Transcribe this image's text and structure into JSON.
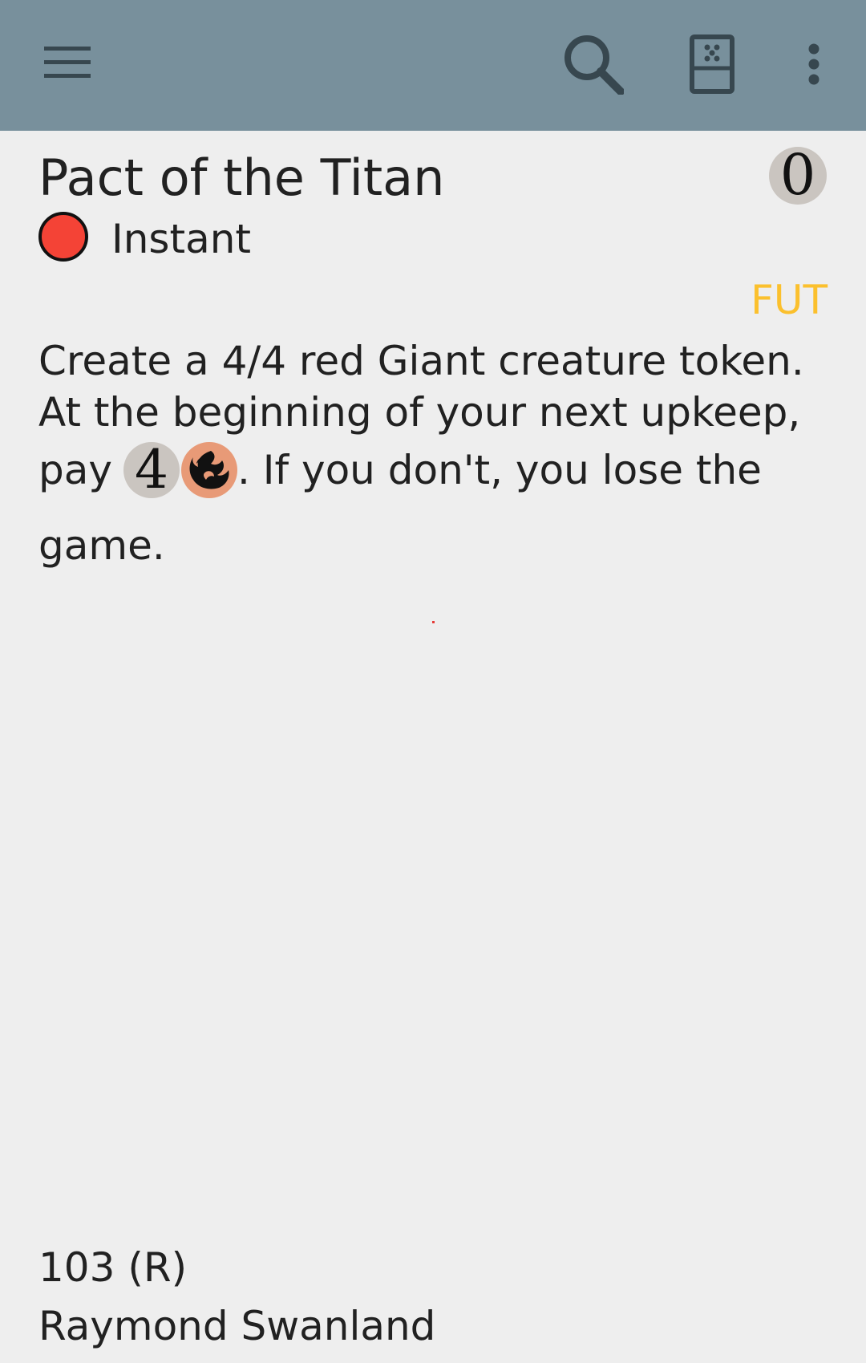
{
  "toolbar": {
    "menu_icon": "hamburger-menu-icon",
    "search_icon": "search-icon",
    "deck_icon": "deck-icon",
    "more_icon": "more-vert-icon"
  },
  "card": {
    "name": "Pact of the Titan",
    "mana_cost": "0",
    "color_indicator": "#f44336",
    "type_line": "Instant",
    "set_code": "FUT",
    "rules_text": {
      "line1": "Create a 4/4 red Giant creature token.",
      "line2": "At the beginning of your next upkeep,",
      "line3_before": "pay",
      "cost_generic": "4",
      "cost_red_icon": "red-mana-icon",
      "line3_after": ". If you don't, you lose the",
      "line4": "game."
    },
    "collector_number": "103 (R)",
    "artist": "Raymond Swanland"
  },
  "colors": {
    "appbar": "#78909c",
    "background": "#eeeeee",
    "set_code": "#fbc02d",
    "mana_generic": "#cac5c0",
    "mana_red": "#e89a77"
  }
}
